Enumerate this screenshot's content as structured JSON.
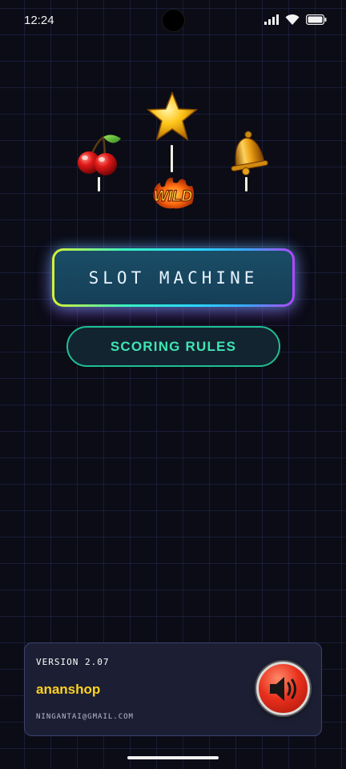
{
  "status_bar": {
    "time": "12:24"
  },
  "symbols": {
    "cherry": "cherry-icon",
    "star": "star-icon",
    "wild": "WILD",
    "bell": "bell-icon"
  },
  "menu": {
    "slot_label": "SLOT MACHINE",
    "rules_label": "SCORING RULES"
  },
  "footer": {
    "version": "VERSION 2.07",
    "name": "ananshop",
    "email": "NINGANTAI@GMAIL.COM"
  },
  "colors": {
    "background": "#0b0c16",
    "accent_teal": "#3ee6b2",
    "brand_yellow": "#ffd21f",
    "speaker_red": "#e8301c"
  }
}
